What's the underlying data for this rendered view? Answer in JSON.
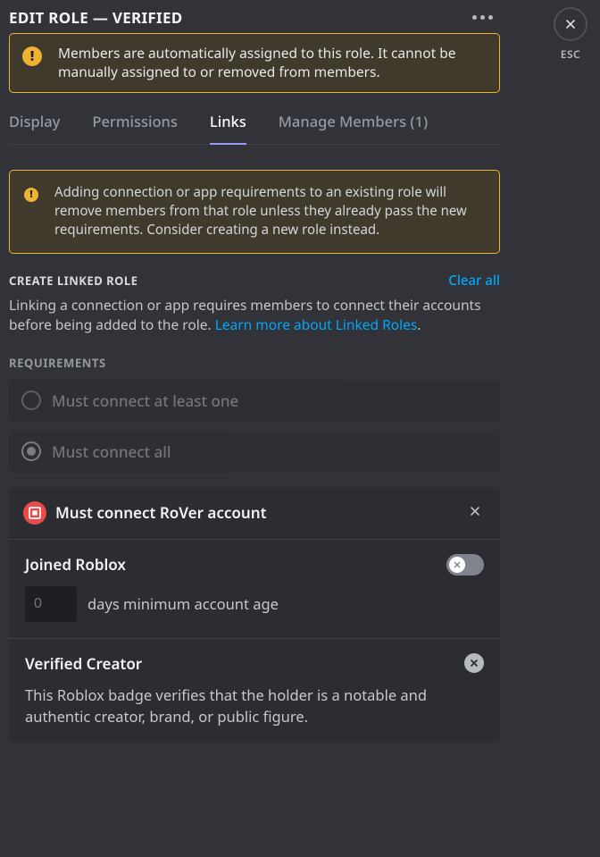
{
  "header": {
    "title": "EDIT ROLE — VERIFIED",
    "esc": "ESC"
  },
  "banner1": "Members are automatically assigned to this role. It cannot be manually assigned to or removed from members.",
  "tabs": {
    "display": "Display",
    "permissions": "Permissions",
    "links": "Links",
    "members": "Manage Members (1)"
  },
  "banner2": "Adding connection or app requirements to an existing role will remove members from that role unless they already pass the new requirements. Consider creating a new role instead.",
  "create": {
    "label": "CREATE LINKED ROLE",
    "clear": "Clear all",
    "desc": "Linking a connection or app requires members to connect their accounts before being added to the role. ",
    "learn": "Learn more about Linked Roles"
  },
  "requirements": {
    "label": "REQUIREMENTS",
    "opt_one": "Must connect at least one",
    "opt_all": "Must connect all"
  },
  "card": {
    "title": "Must connect RoVer account",
    "joined": {
      "title": "Joined Roblox",
      "placeholder": "0",
      "suffix": "days minimum account age"
    },
    "verified": {
      "title": "Verified Creator",
      "desc": "This Roblox badge verifies that the holder is a notable and authentic creator, brand, or public figure."
    }
  }
}
